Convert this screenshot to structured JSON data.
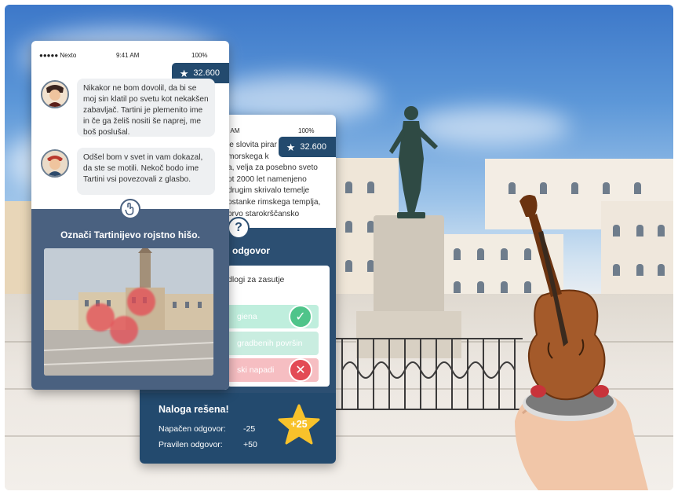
{
  "back_phone": {
    "status_time": "9:41 AM",
    "status_battery": "100%",
    "score": "32.600",
    "story_lines": [
      "je slovita pirar",
      "morskega k",
      "a, velja za posebno sveto",
      "ot 2000 let namenjeno",
      "drugim skrivalo temelje",
      "ostanke rimskega templja,",
      "prvo starokrščansko"
    ],
    "question_label": "odgovor",
    "question_text": "dlogi za zasutje",
    "answers": [
      {
        "text": "giena",
        "state": "correct",
        "icon": "check-icon"
      },
      {
        "text": "gradbenih površin",
        "state": "neutral",
        "icon": ""
      },
      {
        "text": "ski napadi",
        "state": "wrong",
        "icon": "cross-icon"
      }
    ],
    "result": {
      "title": "Naloga rešena!",
      "wrong_label": "Napačen odgovor:",
      "wrong_points": "-25",
      "right_label": "Pravilen odgovor:",
      "right_points": "+50",
      "bonus": "+25"
    }
  },
  "front_phone": {
    "carrier": "●●●●● Nexto",
    "status_time": "9:41 AM",
    "status_battery": "100%",
    "score": "32.600",
    "messages": [
      {
        "speaker": "tartini-father",
        "text": "Nikakor ne bom dovolil, da bi se moj sin klatil po svetu kot nekakšen zabavljač. Tartini je plemenito ime in če ga želiš nositi še naprej, me boš poslušal."
      },
      {
        "speaker": "giuseppe-tartini",
        "text": "Odšel bom v svet in vam dokazal, da ste se motili. Nekoč bodo ime Tartini vsi povezovali z glasbo."
      }
    ],
    "task": "Označi Tartinijevo rojstno hišo.",
    "task_icon": "hand-tap-icon"
  },
  "colors": {
    "navy": "#234a6e",
    "panel": "#4a6180",
    "correct": "#4fc48a",
    "wrong": "#e34a55",
    "bonus_star": "#f8c22b"
  }
}
